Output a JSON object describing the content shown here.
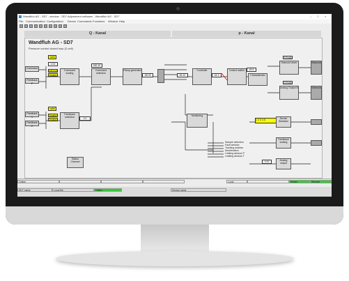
{
  "window": {
    "title": "Wandfluh AG - SD7 - window - SD7 Adjustment software - Wandfluh AG - SD7"
  },
  "menu": [
    "File",
    "Communication",
    "Configuration",
    "Device",
    "Commands",
    "Functions",
    "Window",
    "Help"
  ],
  "tabs": {
    "q_channel": "Q - Kanal",
    "p_channel": "p - Kanal"
  },
  "panel": {
    "title": "Wandfluh AG - SD7",
    "subtitle": "Pressure control closed loop (2-cell)"
  },
  "diagram": {
    "inputs": [
      "Command",
      "Feedback P",
      "Feedback 1",
      "Feedback 2"
    ],
    "blocks": [
      "Command scaling",
      "Command selection",
      "Ramp generator",
      "Controller",
      "Control switch",
      "Characteristic",
      "Solenoid driver",
      "Analog Output B",
      "Monitoring",
      "Device Selection",
      "Feedback scaling",
      "Analog output",
      "Feedback selection",
      "Analog outputs",
      "Status Channel",
      "Internal command",
      "Device"
    ],
    "outputs": [
      "Solenoid",
      "Solenoid"
    ],
    "values": [
      "0.00",
      "452.20",
      "-65.00",
      "63.10",
      "44.3",
      "49.5",
      "0.0",
      "0.00",
      "S/S/AB",
      "S/S/AB"
    ],
    "yellow_values": [
      "valid",
      "Internal",
      "Analog A/D",
      "Analog 1/D",
      "valid",
      "Analog 1/D",
      "Analog 1/D"
    ],
    "notes": [
      "Sample selection",
      "Fault window",
      "Tracking window",
      "Deceleration",
      "Limiting window P",
      "Limiting window T"
    ],
    "channels": [
      "1",
      "2",
      "3",
      "4",
      "5",
      "6",
      "7",
      "8",
      "9"
    ]
  },
  "statusbar": [
    "Online",
    "",
    "",
    "",
    "Local",
    "",
    "Ready",
    "Remote"
  ],
  "taskbar": [
    "SD7 name",
    "Local file",
    "Online",
    "Device name"
  ],
  "colors": {
    "ok": "#33cc33",
    "highlight": "#ffff00",
    "block": "#d9d9d9",
    "output": "#aaaaaa"
  }
}
